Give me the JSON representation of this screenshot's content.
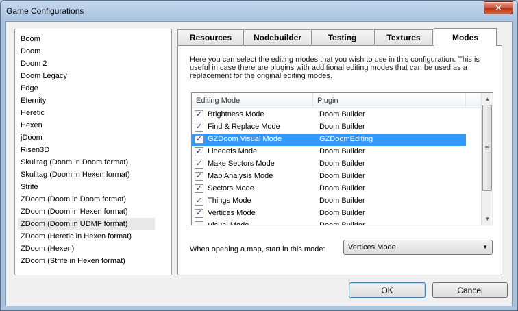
{
  "window": {
    "title": "Game Configurations",
    "close_label": "✕"
  },
  "configs": [
    "Boom",
    "Doom",
    "Doom 2",
    "Doom Legacy",
    "Edge",
    "Eternity",
    "Heretic",
    "Hexen",
    "jDoom",
    "Risen3D",
    "Skulltag (Doom in Doom format)",
    "Skulltag (Doom in Hexen format)",
    "Strife",
    "ZDoom (Doom in Doom format)",
    "ZDoom (Doom in Hexen format)",
    "ZDoom (Doom in UDMF format)",
    "ZDoom (Heretic in Hexen format)",
    "ZDoom (Hexen)",
    "ZDoom (Strife in Hexen format)"
  ],
  "selected_config": "ZDoom (Doom in UDMF format)",
  "tabs": [
    "Resources",
    "Nodebuilder",
    "Testing",
    "Textures",
    "Modes"
  ],
  "active_tab": "Modes",
  "modes_tab": {
    "description": "Here you can select the editing modes that you wish to use in this configuration. This is useful in case there are plugins with additional editing modes that can be used as a replacement for the original editing modes.",
    "columns": [
      "Editing Mode",
      "Plugin"
    ],
    "rows": [
      {
        "mode": "Brightness Mode",
        "plugin": "Doom Builder",
        "checked": true
      },
      {
        "mode": "Find & Replace Mode",
        "plugin": "Doom Builder",
        "checked": true
      },
      {
        "mode": "GZDoom Visual Mode",
        "plugin": "GZDoomEditing",
        "checked": true
      },
      {
        "mode": "Linedefs Mode",
        "plugin": "Doom Builder",
        "checked": true
      },
      {
        "mode": "Make Sectors Mode",
        "plugin": "Doom Builder",
        "checked": true
      },
      {
        "mode": "Map Analysis Mode",
        "plugin": "Doom Builder",
        "checked": true
      },
      {
        "mode": "Sectors Mode",
        "plugin": "Doom Builder",
        "checked": true
      },
      {
        "mode": "Things Mode",
        "plugin": "Doom Builder",
        "checked": true
      },
      {
        "mode": "Vertices Mode",
        "plugin": "Doom Builder",
        "checked": true
      },
      {
        "mode": "Visual Mode",
        "plugin": "Doom Builder",
        "checked": false
      }
    ],
    "selected_row": "GZDoom Visual Mode",
    "start_mode_label": "When opening a map, start in this mode:",
    "start_mode_value": "Vertices Mode"
  },
  "buttons": {
    "ok": "OK",
    "cancel": "Cancel"
  },
  "colors": {
    "selection": "#3399ff",
    "titlebar": "#aec8e4",
    "close": "#c7472d"
  }
}
